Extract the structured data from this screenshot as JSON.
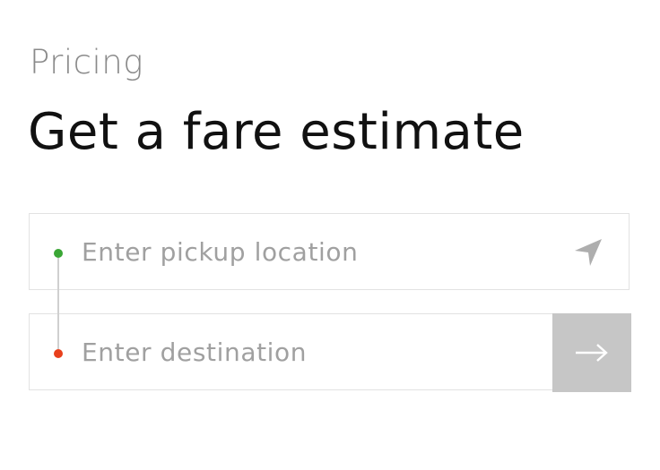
{
  "header": {
    "eyebrow": "Pricing",
    "title": "Get a fare estimate"
  },
  "form": {
    "pickup": {
      "placeholder": "Enter pickup location",
      "value": "",
      "icon": "location-arrow-icon"
    },
    "destination": {
      "placeholder": "Enter destination",
      "value": "",
      "submit_icon": "arrow-right-icon"
    }
  },
  "colors": {
    "pickup_dot": "#3aa635",
    "destination_dot": "#e8401c",
    "submit_bg": "#c6c6c6",
    "icon": "#aeaeae",
    "border": "#e2e2e2"
  }
}
